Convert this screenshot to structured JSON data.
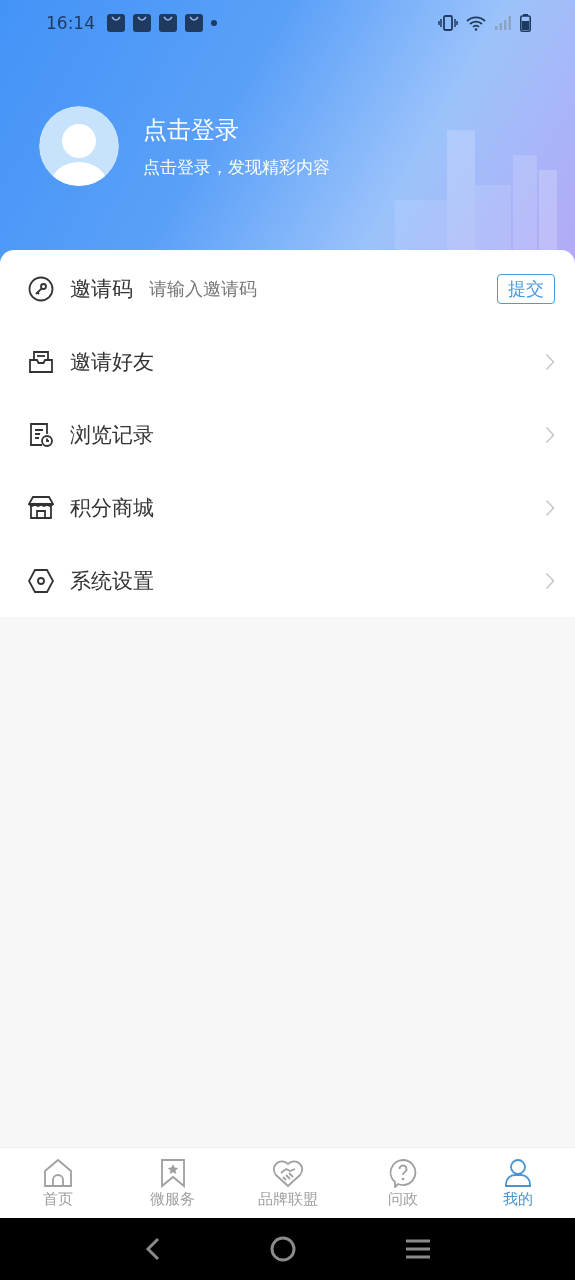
{
  "status_bar": {
    "time": "16:14"
  },
  "profile": {
    "title": "点击登录",
    "subtitle": "点击登录，发现精彩内容"
  },
  "menu": [
    {
      "kind": "invite-code",
      "label": "邀请码",
      "placeholder": "请输入邀请码",
      "button": "提交"
    },
    {
      "kind": "link",
      "label": "邀请好友"
    },
    {
      "kind": "link",
      "label": "浏览记录"
    },
    {
      "kind": "link",
      "label": "积分商城"
    },
    {
      "kind": "link",
      "label": "系统设置"
    }
  ],
  "tabs": [
    {
      "label": "首页",
      "selected": false
    },
    {
      "label": "微服务",
      "selected": false
    },
    {
      "label": "品牌联盟",
      "selected": false
    },
    {
      "label": "问政",
      "selected": false
    },
    {
      "label": "我的",
      "selected": true
    }
  ]
}
